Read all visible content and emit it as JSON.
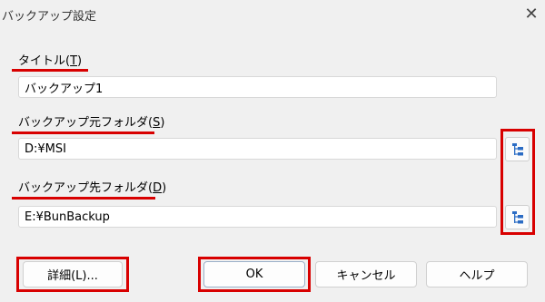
{
  "window": {
    "title": "バックアップ設定",
    "close_glyph": "✕"
  },
  "fields": {
    "title": {
      "label": "タイトル(",
      "mnemonic": "T",
      "label_end": ")",
      "value": "バックアップ1"
    },
    "source": {
      "label": "バックアップ元フォルダ(",
      "mnemonic": "S",
      "label_end": ")",
      "value": "D:¥MSI"
    },
    "dest": {
      "label": "バックアップ先フォルダ(",
      "mnemonic": "D",
      "label_end": ")",
      "value": "E:¥BunBackup"
    }
  },
  "buttons": {
    "details": "詳細(L)...",
    "ok": "OK",
    "cancel": "キャンセル",
    "help": "ヘルプ"
  },
  "icons": {
    "browse": "folder-tree-icon",
    "close": "close-icon"
  },
  "colors": {
    "highlight": "#d80000",
    "icon_blue": "#2b6cc4"
  }
}
